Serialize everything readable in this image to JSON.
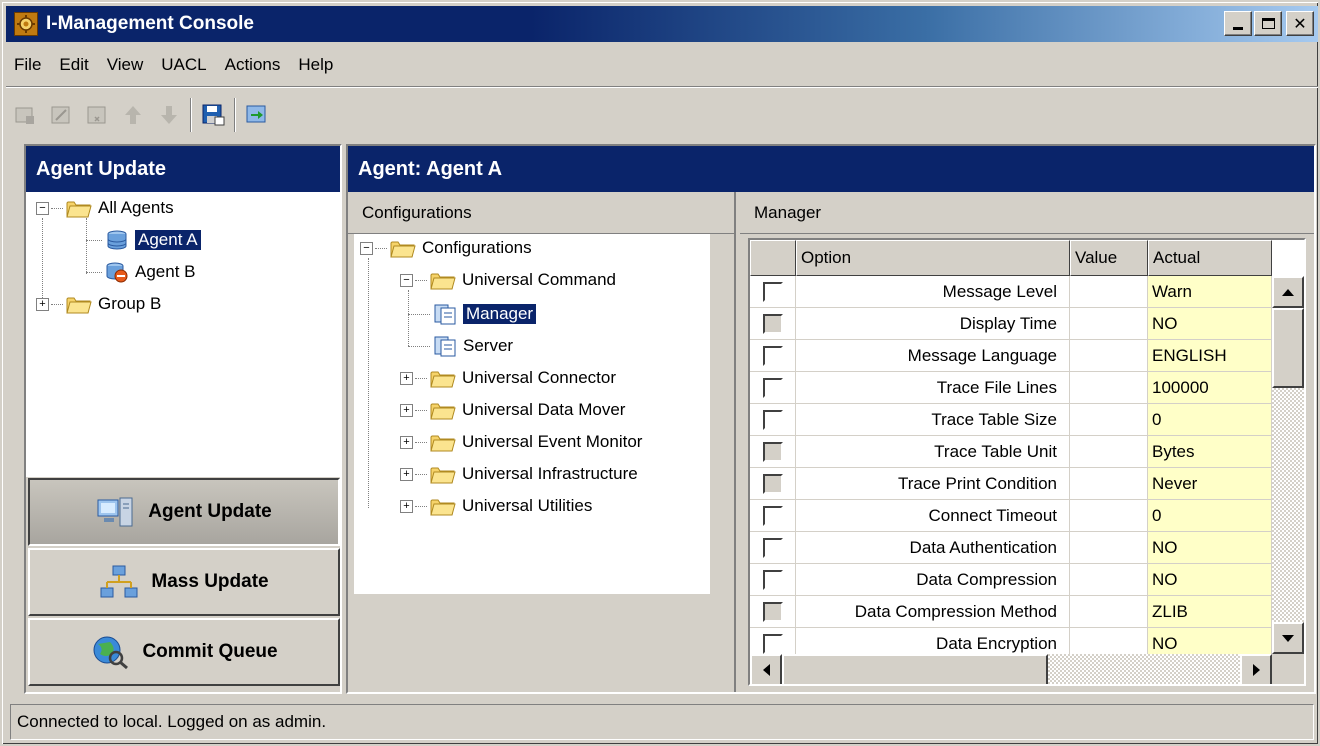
{
  "window": {
    "title": "I-Management Console"
  },
  "menu": [
    "File",
    "Edit",
    "View",
    "UACL",
    "Actions",
    "Help"
  ],
  "left_panel": {
    "title": "Agent Update",
    "tree": {
      "root": "All Agents",
      "agent_a": "Agent A",
      "agent_b": "Agent B",
      "group_b": "Group B"
    },
    "nav": {
      "agent_update": "Agent Update",
      "mass_update": "Mass Update",
      "commit_queue": "Commit Queue"
    }
  },
  "right_panel": {
    "title": "Agent:  Agent A",
    "configurations": {
      "caption": "Configurations",
      "root": "Configurations",
      "universal_command": "Universal Command",
      "manager": "Manager",
      "server": "Server",
      "universal_connector": "Universal Connector",
      "universal_data_mover": "Universal Data Mover",
      "universal_event_monitor": "Universal Event Monitor",
      "universal_infrastructure": "Universal Infrastructure",
      "universal_utilities": "Universal Utilities"
    },
    "manager": {
      "caption": "Manager",
      "columns": {
        "option": "Option",
        "value": "Value",
        "actual": "Actual"
      },
      "rows": [
        {
          "option": "Message Level",
          "value": "",
          "actual": "Warn"
        },
        {
          "option": "Display Time",
          "value": "",
          "actual": "NO"
        },
        {
          "option": "Message Language",
          "value": "",
          "actual": "ENGLISH"
        },
        {
          "option": "Trace File Lines",
          "value": "",
          "actual": "100000"
        },
        {
          "option": "Trace Table Size",
          "value": "",
          "actual": "0"
        },
        {
          "option": "Trace Table Unit",
          "value": "",
          "actual": "Bytes"
        },
        {
          "option": "Trace Print Condition",
          "value": "",
          "actual": "Never"
        },
        {
          "option": "Connect Timeout",
          "value": "",
          "actual": "0"
        },
        {
          "option": "Data Authentication",
          "value": "",
          "actual": "NO"
        },
        {
          "option": "Data Compression",
          "value": "",
          "actual": "NO"
        },
        {
          "option": "Data Compression Method",
          "value": "",
          "actual": "ZLIB"
        },
        {
          "option": "Data Encryption",
          "value": "",
          "actual": "NO"
        }
      ]
    }
  },
  "status": {
    "text": "Connected to local.  Logged on as admin."
  }
}
